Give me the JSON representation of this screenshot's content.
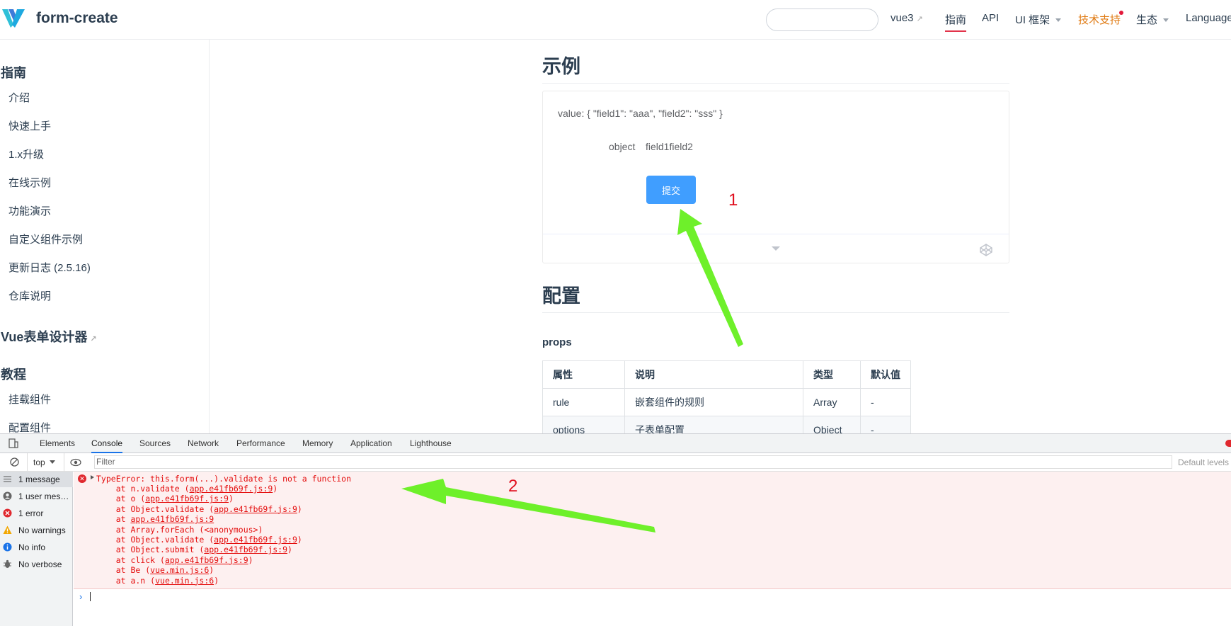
{
  "header": {
    "brand": "form-create",
    "search_placeholder": "",
    "nav": {
      "vue3": "vue3",
      "guide": "指南",
      "api": "API",
      "ui": "UI 框架",
      "support": "技术支持",
      "ecosystem": "生态",
      "language": "Language"
    }
  },
  "sidebar": {
    "group1": "指南",
    "items1": [
      "介绍",
      "快速上手",
      "1.x升级",
      "在线示例",
      "功能演示",
      "自定义组件示例",
      "更新日志 (2.5.16)",
      "仓库说明"
    ],
    "group2": "Vue表单设计器",
    "group3": "教程",
    "items3": [
      "挂载组件",
      "配置组件"
    ]
  },
  "main": {
    "example_title": "示例",
    "demo": {
      "value_text": "value: { \"field1\": \"aaa\", \"field2\": \"sss\" }",
      "label": "object",
      "field_text": "field1field2",
      "submit": "提交"
    },
    "config_title": "配置",
    "props_title": "props",
    "table": {
      "headers": [
        "属性",
        "说明",
        "类型",
        "默认值"
      ],
      "rows": [
        [
          "rule",
          "嵌套组件的规则",
          "Array",
          "-"
        ],
        [
          "options",
          "子表单配置",
          "Object",
          "-"
        ]
      ]
    }
  },
  "annotations": {
    "one": "1",
    "two": "2",
    "arrow_color": "#6ef02a"
  },
  "devtools": {
    "tabs": [
      "Elements",
      "Console",
      "Sources",
      "Network",
      "Performance",
      "Memory",
      "Application",
      "Lighthouse"
    ],
    "context": "top",
    "filter_placeholder": "Filter",
    "default_levels": "Default levels",
    "sidebar": [
      "1 message",
      "1 user mes…",
      "1 error",
      "No warnings",
      "No info",
      "No verbose"
    ],
    "error": {
      "message": "TypeError: this.form(...).validate is not a function",
      "stack": [
        {
          "pre": "    at n.validate (",
          "link": "app.e41fb69f.js:9",
          "post": ")"
        },
        {
          "pre": "    at o (",
          "link": "app.e41fb69f.js:9",
          "post": ")"
        },
        {
          "pre": "    at Object.validate (",
          "link": "app.e41fb69f.js:9",
          "post": ")"
        },
        {
          "pre": "    at ",
          "link": "app.e41fb69f.js:9",
          "post": ""
        },
        {
          "pre": "    at Array.forEach (<anonymous>)",
          "link": "",
          "post": ""
        },
        {
          "pre": "    at Object.validate (",
          "link": "app.e41fb69f.js:9",
          "post": ")"
        },
        {
          "pre": "    at Object.submit (",
          "link": "app.e41fb69f.js:9",
          "post": ")"
        },
        {
          "pre": "    at click (",
          "link": "app.e41fb69f.js:9",
          "post": ")"
        },
        {
          "pre": "    at Be (",
          "link": "vue.min.js:6",
          "post": ")"
        },
        {
          "pre": "    at a.n (",
          "link": "vue.min.js:6",
          "post": ")"
        }
      ]
    }
  }
}
